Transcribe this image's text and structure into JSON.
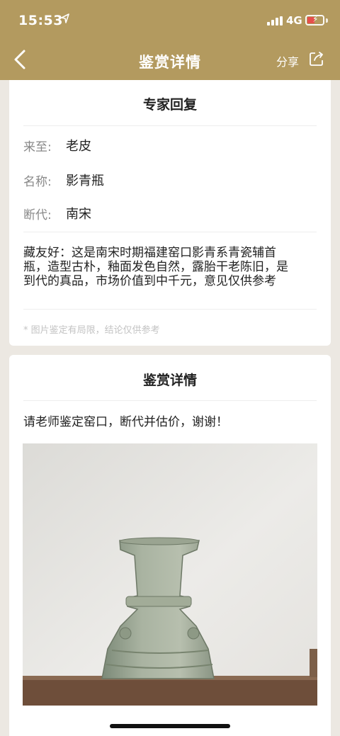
{
  "status": {
    "time": "15:53",
    "location_icon": "location-arrow-icon",
    "network": "4G",
    "battery_state": "charging-low",
    "battery_color": "#e94b4b"
  },
  "navbar": {
    "title": "鉴赏详情",
    "share_label": "分享",
    "background_color": "#b39a5f"
  },
  "expert_reply": {
    "title": "专家回复",
    "fields": [
      {
        "label": "来至:",
        "value": "老皮"
      },
      {
        "label": "名称:",
        "value": "影青瓶"
      },
      {
        "label": "断代:",
        "value": "南宋"
      }
    ],
    "reply_lines": [
      "藏友好：这是南宋时期福建窑口影青系青瓷辅首",
      "瓶，造型古朴，釉面发色自然，露胎干老陈旧，是",
      "到代的真品，市场价值到中千元，意见仅供参考"
    ],
    "disclaimer": "* 图片鉴定有局限，结论仅供参考"
  },
  "appraisal_detail": {
    "title": "鉴赏详情",
    "request": "请老师鉴定窑口，断代并估价，谢谢！",
    "photo_subject": "celadon-vase-photo"
  }
}
